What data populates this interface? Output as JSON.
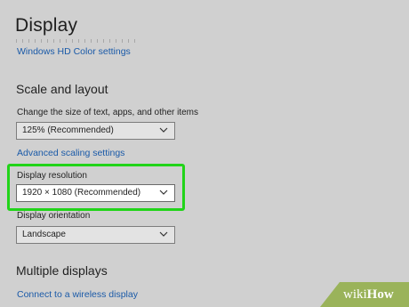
{
  "page": {
    "title": "Display",
    "hd_color_link": "Windows HD Color settings"
  },
  "scale_layout": {
    "heading": "Scale and layout",
    "text_size_label": "Change the size of text, apps, and other items",
    "text_size_value": "125% (Recommended)",
    "advanced_scaling_link": "Advanced scaling settings"
  },
  "resolution": {
    "label": "Display resolution",
    "value": "1920 × 1080 (Recommended)",
    "highlight_color": "#21d419"
  },
  "orientation": {
    "label": "Display orientation",
    "value": "Landscape"
  },
  "multiple_displays": {
    "heading": "Multiple displays",
    "wireless_link": "Connect to a wireless display"
  },
  "watermark": {
    "prefix": "wiki",
    "suffix": "How",
    "color": "#9ab35a"
  },
  "icons": {
    "dropdown": "chevron-down-icon"
  },
  "colors": {
    "background": "#d0d0d0",
    "link": "#1a5aa8"
  }
}
